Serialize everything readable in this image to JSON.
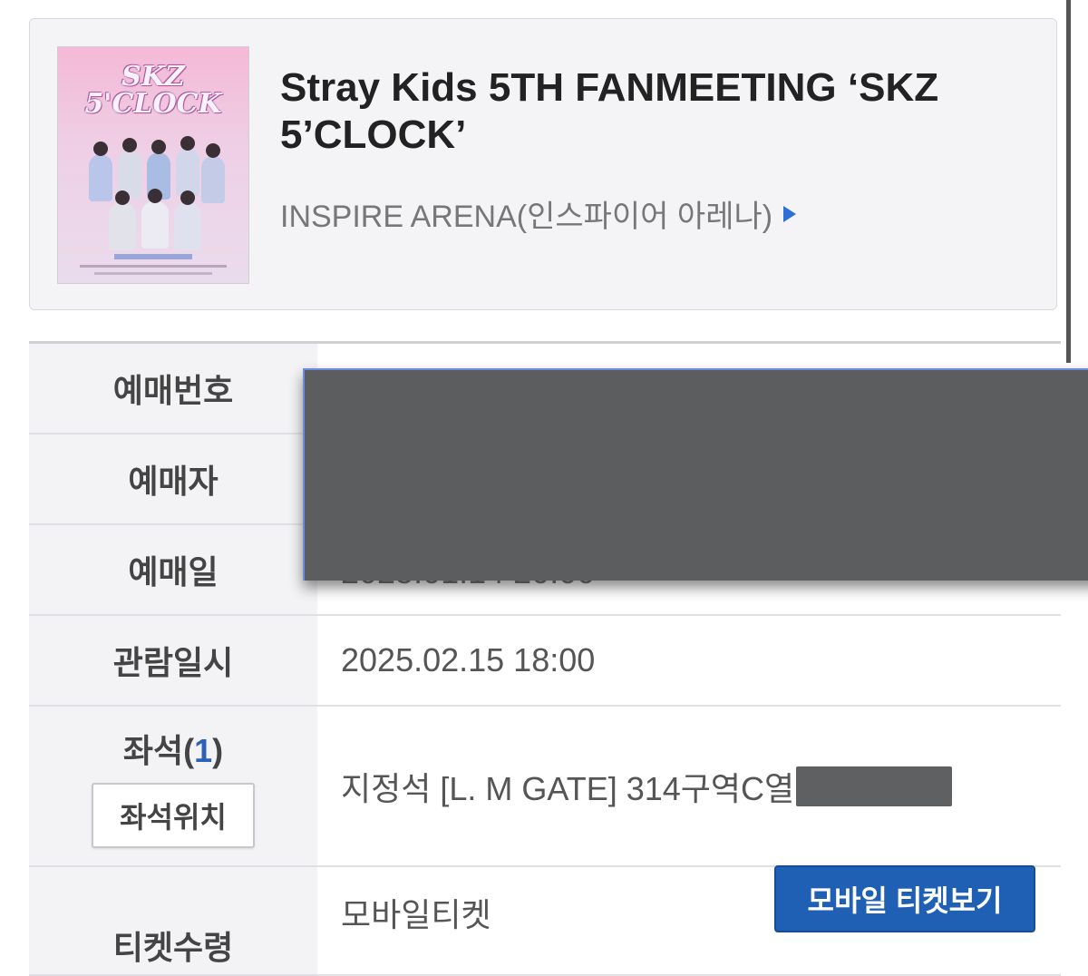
{
  "event": {
    "poster_logo_line1": "SKZ",
    "poster_logo_line2": "5'CLOCK",
    "title": "Stray Kids 5TH FANMEETING ‘SKZ 5’CLOCK’",
    "venue": "INSPIRE ARENA(인스파이어 아레나)"
  },
  "booking": {
    "booking_number_label": "예매번호",
    "booker_label": "예매자",
    "booking_date_label": "예매일",
    "viewing_datetime_label": "관람일시",
    "viewing_datetime_value": "2025.02.15 18:00",
    "seat_label": "좌석",
    "seat_count": "1",
    "seat_location_button": "좌석위치",
    "seat_value": "지정석 [L. M GATE] 314구역C열",
    "ticket_receive_label": "티켓수령",
    "ticket_receive_value": "모바일티켓",
    "mobile_ticket_button": "모바일 티켓보기"
  },
  "colors": {
    "accent_blue": "#1f5fb4",
    "label_bg": "#f3f3f5",
    "redaction": "#5c5d5f"
  },
  "icons": {
    "venue_arrow": "triangle-right-icon"
  }
}
